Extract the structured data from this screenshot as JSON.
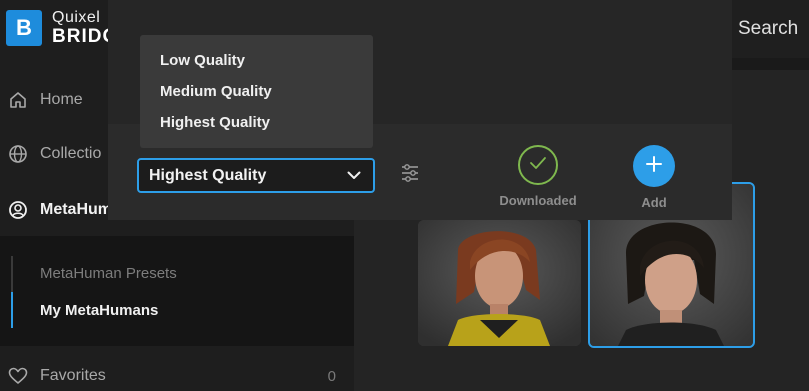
{
  "app": {
    "brand_line1": "Quixel",
    "brand_line2": "BRIDG",
    "logo_letter": "B",
    "accent": "#2d9ee8",
    "logo_color": "#1e8cdc"
  },
  "sidebar": {
    "items": [
      {
        "label": "Home",
        "icon": "home-icon"
      },
      {
        "label": "Collectio",
        "icon": "globe-icon"
      },
      {
        "label": "MetaHum",
        "icon": "user-circle-icon"
      }
    ],
    "subitems": [
      {
        "label": "MetaHuman Presets"
      },
      {
        "label": "My MetaHumans",
        "active": true
      }
    ],
    "favorites": {
      "label": "Favorites",
      "count": "0",
      "icon": "heart-icon"
    }
  },
  "search": {
    "label": "Search"
  },
  "quality": {
    "options": [
      "Low Quality",
      "Medium Quality",
      "Highest Quality"
    ],
    "selected": "Highest Quality"
  },
  "actions": {
    "downloaded_label": "Downloaded",
    "downloaded_color": "#7fb84e",
    "add_label": "Add"
  }
}
